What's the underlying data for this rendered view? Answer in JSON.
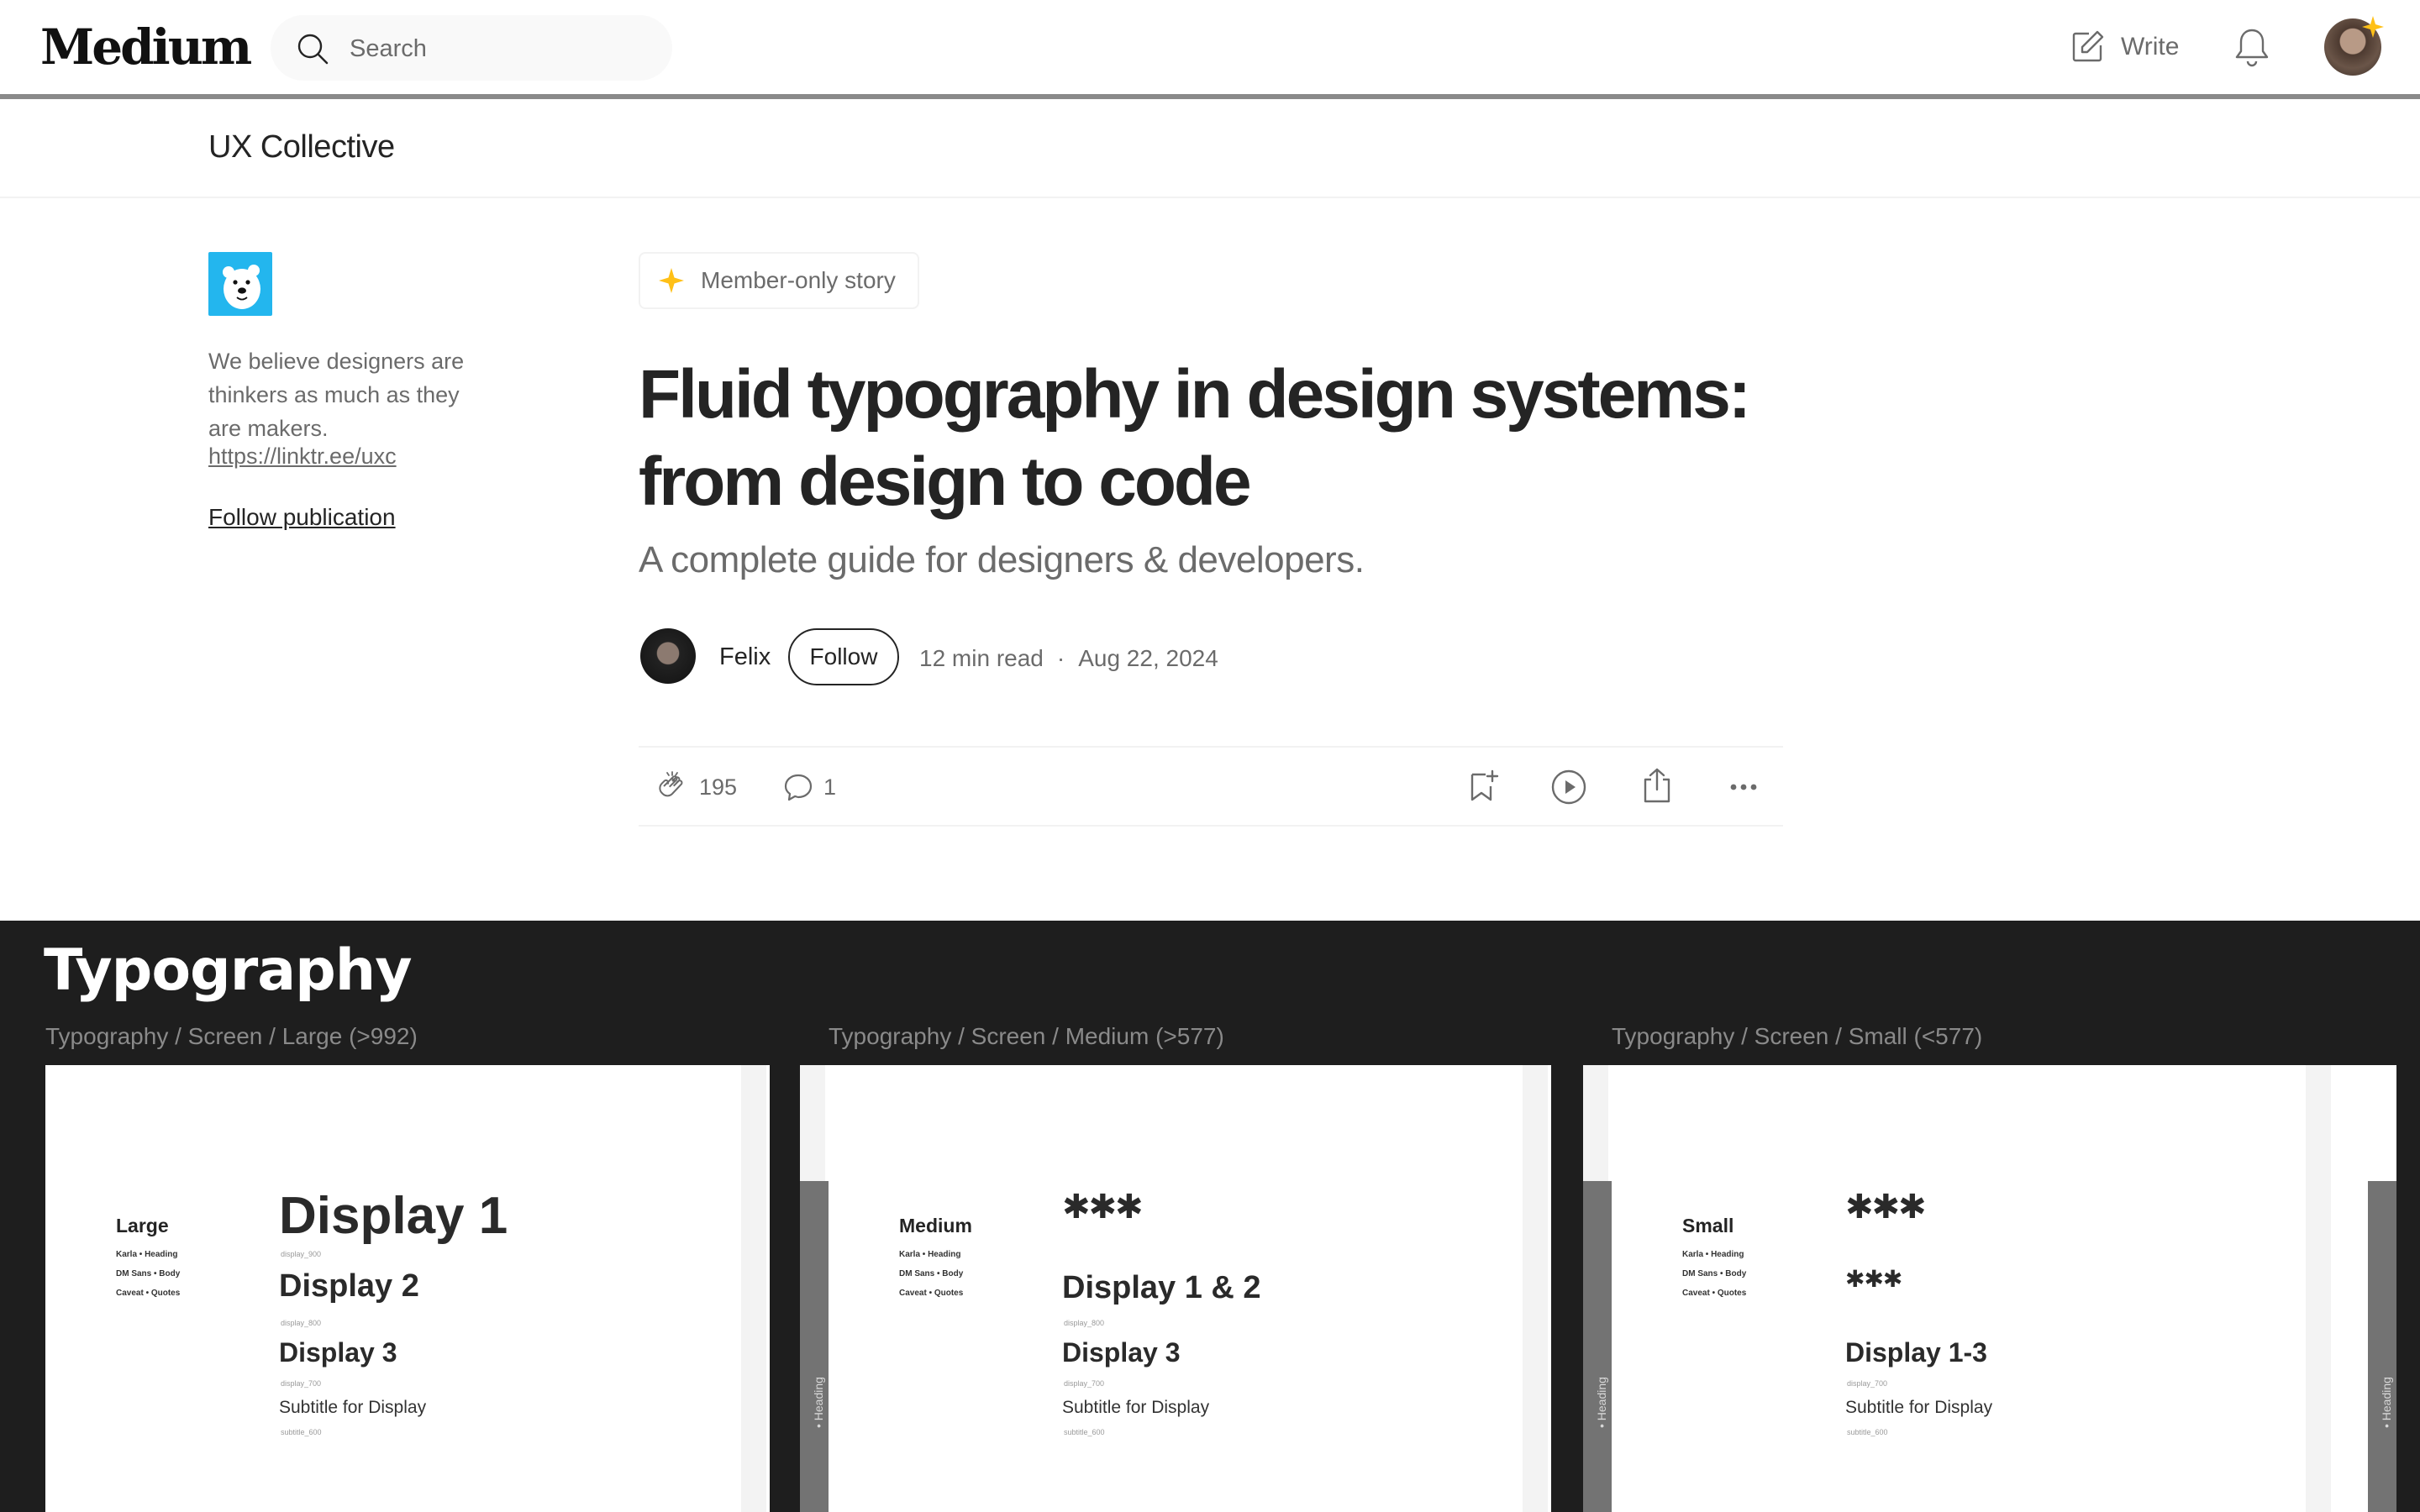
{
  "nav": {
    "logo": "Medium",
    "search_placeholder": "Search",
    "write_label": "Write"
  },
  "publication": {
    "name": "UX Collective",
    "description": "We believe designers are thinkers as much as they are makers.",
    "link": "https://linktr.ee/uxc",
    "follow_label": "Follow publication"
  },
  "article": {
    "badge": "Member-only story",
    "title": "Fluid typography in design systems: from design to code",
    "subtitle": "A complete guide for designers & developers.",
    "author": "Felix",
    "follow_label": "Follow",
    "read_time": "12 min read",
    "separator": "·",
    "date": "Aug 22, 2024",
    "claps": "195",
    "comments": "1"
  },
  "hero": {
    "title": "Typography",
    "frames": [
      {
        "label": "Typography / Screen / Large (>992)",
        "size_name": "Large",
        "fonts": [
          "Karla  •  Heading",
          "DM Sans  •  Body",
          "Caveat  •  Quotes"
        ],
        "displays": [
          {
            "text": "Display 1",
            "token": "display_900"
          },
          {
            "text": "Display  2",
            "token": "display_800"
          },
          {
            "text": "Display 3",
            "token": "display_700"
          },
          {
            "text": "Subtitle for Display",
            "token": "subtitle_600"
          }
        ]
      },
      {
        "label": "Typography / Screen / Medium (>577)",
        "size_name": "Medium",
        "fonts": [
          "Karla  •  Heading",
          "DM Sans  •  Body",
          "Caveat  •  Quotes"
        ],
        "rail_text": "• Heading",
        "displays": [
          {
            "text": "✱✱✱",
            "token": ""
          },
          {
            "text": "Display  1 & 2",
            "token": "display_800"
          },
          {
            "text": "Display 3",
            "token": "display_700"
          },
          {
            "text": "Subtitle for Display",
            "token": "subtitle_600"
          }
        ]
      },
      {
        "label": "Typography / Screen / Small (<577)",
        "size_name": "Small",
        "fonts": [
          "Karla  •  Heading",
          "DM Sans  •  Body",
          "Caveat  •  Quotes"
        ],
        "rail_text": "• Heading",
        "displays": [
          {
            "text": "✱✱✱",
            "token": ""
          },
          {
            "text": "✱✱✱",
            "token": ""
          },
          {
            "text": "Display 1-3",
            "token": "display_700"
          },
          {
            "text": "Subtitle for Display",
            "token": "subtitle_600"
          }
        ]
      }
    ]
  },
  "colors": {
    "text": "#242424",
    "muted": "#6b6b6b",
    "star": "#ffc017",
    "hero_bg": "#1e1e1e",
    "pub_logo_bg": "#23b6ee"
  },
  "icons": {
    "search": "search-icon",
    "write": "write-icon",
    "bell": "bell-icon",
    "star": "star-icon",
    "clap": "clap-icon",
    "comment": "comment-icon",
    "save": "bookmark-add-icon",
    "listen": "play-icon",
    "share": "share-icon",
    "more": "more-icon"
  }
}
